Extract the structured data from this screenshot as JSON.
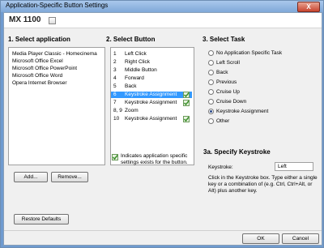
{
  "window": {
    "title": "Application-Specific Button Settings",
    "close_label": "X"
  },
  "header": {
    "title": "MX 1100"
  },
  "sections": {
    "app": "1.   Select application",
    "button": "2.   Select Button",
    "task": "3.   Select Task",
    "keystroke": "3a.  Specify Keystroke"
  },
  "applications": [
    "Media Player Classic - Homecinema",
    "Microsoft Office Excel",
    "Microsoft Office PowerPoint",
    "Microsoft Office Word",
    "Opera Internet Browser"
  ],
  "buttons": [
    {
      "num": "1",
      "label": "Left Click",
      "check": false
    },
    {
      "num": "2",
      "label": "Right Click",
      "check": false
    },
    {
      "num": "3",
      "label": "Middle Button",
      "check": false
    },
    {
      "num": "4",
      "label": "Forward",
      "check": false
    },
    {
      "num": "5",
      "label": "Back",
      "check": false
    },
    {
      "num": "6",
      "label": "Keystroke Assignment",
      "check": true
    },
    {
      "num": "7",
      "label": "Keystroke Assignment",
      "check": true
    },
    {
      "num": "8, 9",
      "label": "Zoom",
      "check": false
    },
    {
      "num": "10",
      "label": "Keystroke Assignment",
      "check": true
    }
  ],
  "tasks": [
    {
      "label": "No Application Specific Task",
      "selected": false
    },
    {
      "label": "Left Scroll",
      "selected": false
    },
    {
      "label": "Back",
      "selected": false
    },
    {
      "label": "Previous",
      "selected": false
    },
    {
      "label": "Cruise Up",
      "selected": false
    },
    {
      "label": "Cruise Down",
      "selected": false
    },
    {
      "label": "Keystroke Assignment",
      "selected": true
    },
    {
      "label": "Other",
      "selected": false
    }
  ],
  "legend_note": "Indicates application specific settings exists for the button.",
  "keystroke": {
    "label": "Keystroke:",
    "value": "Left",
    "help": "Click in the Keystroke box. Type either a single key or a combination of (e.g. Ctrl, Ctrl+Alt, or Alt) plus another key."
  },
  "buttons_labels": {
    "add": "Add...",
    "remove": "Remove...",
    "restore": "Restore Defaults",
    "ok": "OK",
    "cancel": "Cancel"
  },
  "colors": {
    "selection": "#3399ff",
    "check": "#3a8f2a",
    "titlebar": "#7fa8d8"
  }
}
